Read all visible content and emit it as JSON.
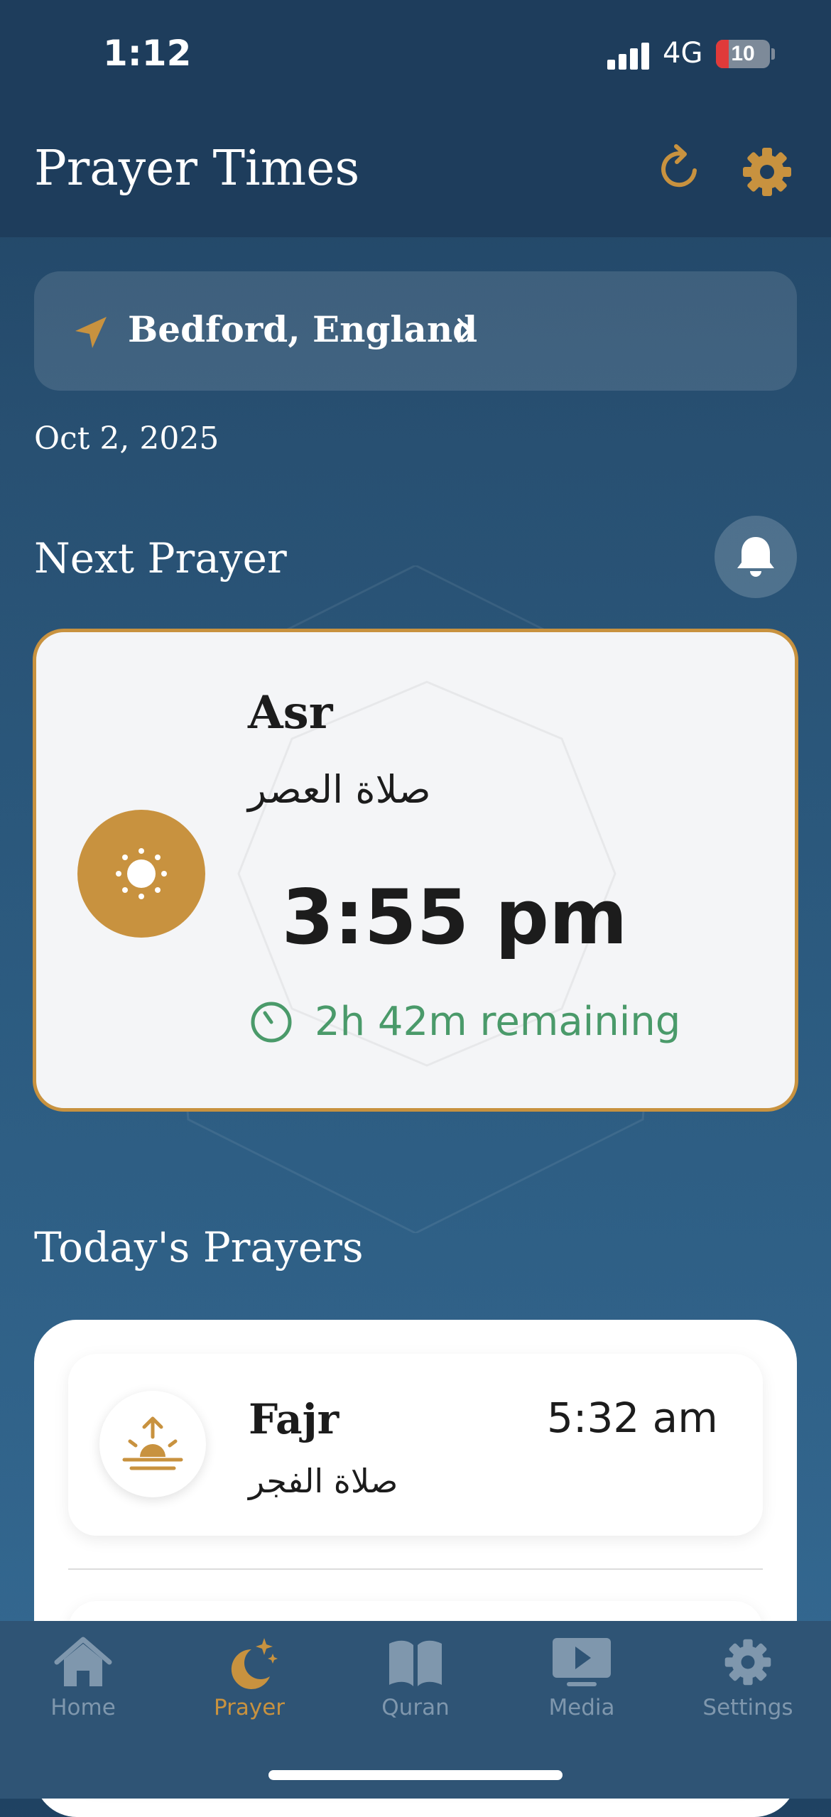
{
  "status_bar": {
    "time": "1:12",
    "network": "4G",
    "battery": "10"
  },
  "header": {
    "title": "Prayer Times"
  },
  "location": {
    "name": "Bedford, England"
  },
  "date": "Oct 2, 2025",
  "next_prayer": {
    "section_label": "Next Prayer",
    "name": "Asr",
    "arabic": "صلاة العصر",
    "time": "3:55 pm",
    "remaining": "2h 42m remaining"
  },
  "today": {
    "section_label": "Today's Prayers",
    "prayers": [
      {
        "name": "Fajr",
        "arabic": "صلاة الفجر",
        "time": "5:32 am"
      }
    ]
  },
  "tabs": [
    {
      "label": "Home",
      "icon": "home-icon",
      "active": false
    },
    {
      "label": "Prayer",
      "icon": "moon-star-icon",
      "active": true
    },
    {
      "label": "Quran",
      "icon": "book-icon",
      "active": false
    },
    {
      "label": "Media",
      "icon": "play-icon",
      "active": false
    },
    {
      "label": "Settings",
      "icon": "gear-icon",
      "active": false
    }
  ],
  "colors": {
    "accent": "#c8923f",
    "remaining": "#4a9a6a",
    "header_bg": "#1e3d5c",
    "tab_inactive": "#7f97ad"
  }
}
